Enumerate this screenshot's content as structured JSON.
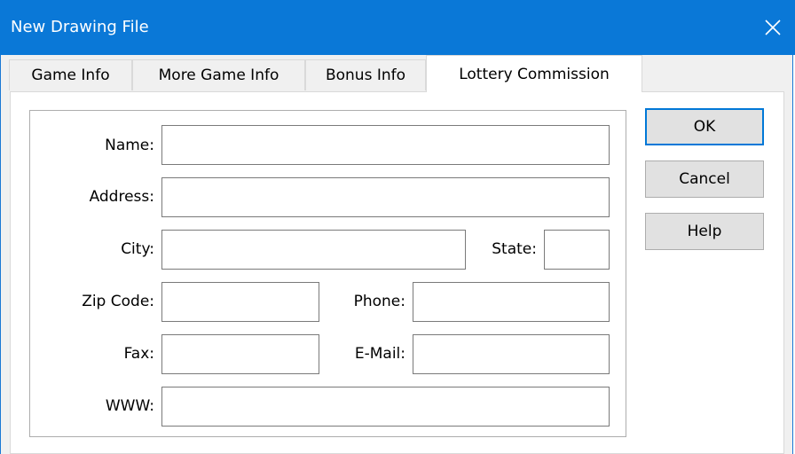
{
  "window": {
    "title": "New Drawing File",
    "close_icon": "×"
  },
  "tabs": [
    {
      "label": "Game Info"
    },
    {
      "label": "More Game Info"
    },
    {
      "label": "Bonus Info"
    },
    {
      "label": "Lottery Commission",
      "active": true
    }
  ],
  "form": {
    "name": {
      "label": "Name:",
      "value": ""
    },
    "address": {
      "label": "Address:",
      "value": ""
    },
    "city": {
      "label": "City:",
      "value": ""
    },
    "state": {
      "label": "State:",
      "value": ""
    },
    "zip": {
      "label": "Zip Code:",
      "value": ""
    },
    "phone": {
      "label": "Phone:",
      "value": ""
    },
    "fax": {
      "label": "Fax:",
      "value": ""
    },
    "email": {
      "label": "E-Mail:",
      "value": ""
    },
    "www": {
      "label": "WWW:",
      "value": ""
    }
  },
  "buttons": {
    "ok": "OK",
    "cancel": "Cancel",
    "help": "Help"
  },
  "colors": {
    "titlebar": "#0a78d7",
    "default_button_border": "#0078d7"
  }
}
